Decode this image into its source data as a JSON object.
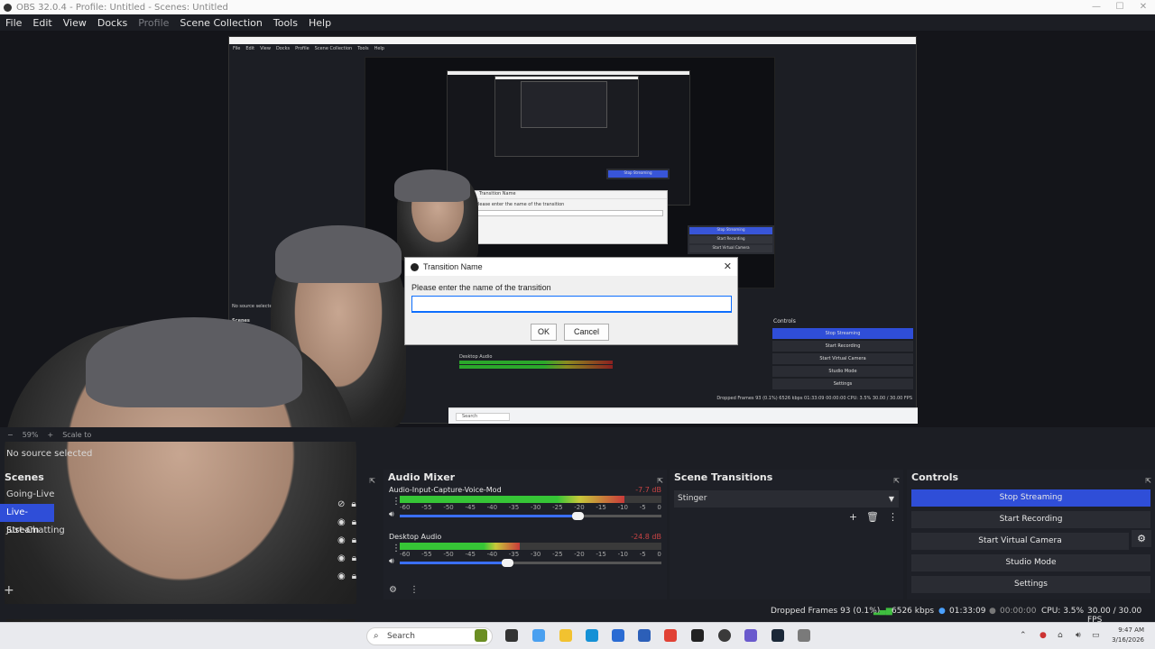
{
  "window": {
    "title": "OBS 32.0.4 - Profile: Untitled - Scenes: Untitled"
  },
  "menu": [
    "File",
    "Edit",
    "View",
    "Docks",
    "Profile",
    "Scene Collection",
    "Tools",
    "Help"
  ],
  "dialog": {
    "title": "Transition Name",
    "prompt": "Please enter the name of the transition",
    "input_value": "",
    "ok": "OK",
    "cancel": "Cancel",
    "close": "✕"
  },
  "zoombar": {
    "zoom": "59%",
    "scale": "Scale to"
  },
  "source_bar": "No source selected",
  "scenes": {
    "title": "Scenes",
    "items": [
      "Going-Live",
      "Live-Stream",
      "Just-Chatting"
    ],
    "selected": 1
  },
  "mixer": {
    "title": "Audio Mixer",
    "channels": [
      {
        "name": "Audio-Input-Capture-Voice-Mod",
        "db": "-7.7 dB",
        "level": 0.86,
        "volume": 0.68
      },
      {
        "name": "Desktop Audio",
        "db": "-24.8 dB",
        "level": 0.46,
        "volume": 0.41
      }
    ],
    "scale": [
      "-60",
      "-55",
      "-50",
      "-45",
      "-40",
      "-35",
      "-30",
      "-25",
      "-20",
      "-15",
      "-10",
      "-5",
      "0"
    ]
  },
  "transitions": {
    "title": "Scene Transitions",
    "selected": "Stinger"
  },
  "controls": {
    "title": "Controls",
    "buttons": [
      "Stop Streaming",
      "Start Recording",
      "Start Virtual Camera",
      "Studio Mode",
      "Settings"
    ]
  },
  "status": {
    "dropped": "Dropped Frames 93 (0.1%)",
    "kbps": "6526 kbps",
    "stream_time": "01:33:09",
    "rec_time": "00:00:00",
    "cpu": "CPU: 3.5%",
    "fps": "30.00 / 30.00 FPS"
  },
  "taskbar": {
    "search": "Search",
    "time": "9:47 AM",
    "date": "3/16/2026"
  },
  "nested": {
    "stop": "Stop Streaming",
    "start_rec": "Start Recording",
    "vcam": "Start Virtual Camera",
    "studio": "Studio Mode",
    "settings": "Settings",
    "controls": "Controls",
    "no_source": "No source selected",
    "scenes": "Scenes",
    "desktop_audio": "Desktop Audio",
    "dialog_title": "Transition Name",
    "dialog_prompt": "Please enter the name of the transition",
    "status": "Dropped Frames 93 (0.1%)  6526 kbps  01:33:09  00:00:00  CPU: 3.5%  30.00 / 30.00 FPS",
    "search": "Search"
  }
}
